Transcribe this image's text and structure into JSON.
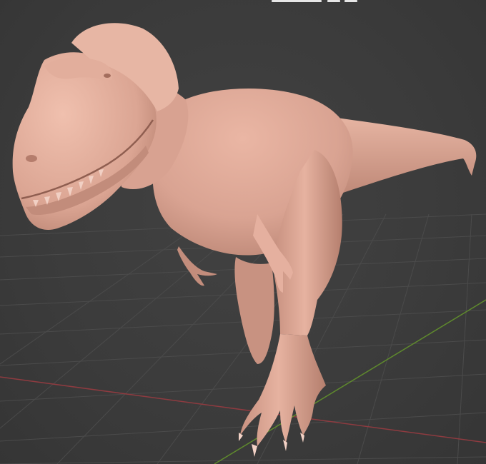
{
  "viewport": {
    "background": "#3d3d3d",
    "grid_color": "#4a4a4a",
    "x_axis_color": "#8e3b40",
    "y_axis_color": "#5f8a2d"
  },
  "model": {
    "name_icon": "trex-model",
    "skin_color": "#dba593",
    "shadow_color": "#b6806f",
    "highlight_color": "#f0c2b1",
    "claw_color": "#f3d2c6"
  }
}
